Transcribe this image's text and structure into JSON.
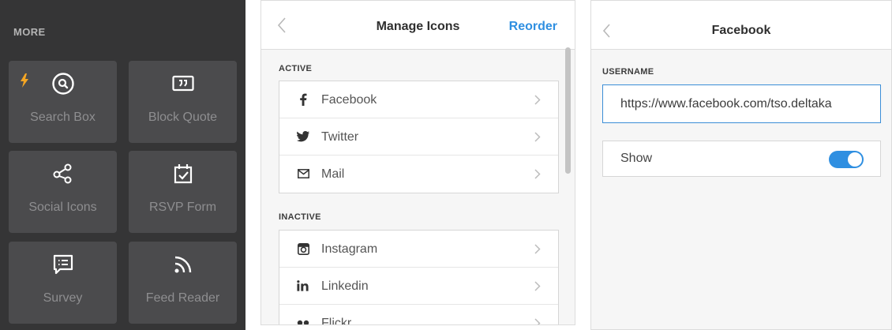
{
  "more_panel": {
    "title": "MORE",
    "tiles": [
      {
        "label": "Search Box",
        "icon": "search-icon"
      },
      {
        "label": "Block Quote",
        "icon": "quote-icon"
      },
      {
        "label": "Social Icons",
        "icon": "share-icon"
      },
      {
        "label": "RSVP Form",
        "icon": "calendar-check-icon"
      },
      {
        "label": "Survey",
        "icon": "survey-icon"
      },
      {
        "label": "Feed Reader",
        "icon": "rss-icon"
      }
    ],
    "accent_color": "#f5a623"
  },
  "manage_icons": {
    "title": "Manage Icons",
    "reorder_label": "Reorder",
    "active_label": "ACTIVE",
    "inactive_label": "INACTIVE",
    "active": [
      {
        "label": "Facebook",
        "icon": "facebook-icon"
      },
      {
        "label": "Twitter",
        "icon": "twitter-icon"
      },
      {
        "label": "Mail",
        "icon": "mail-icon"
      }
    ],
    "inactive": [
      {
        "label": "Instagram",
        "icon": "instagram-icon"
      },
      {
        "label": "Linkedin",
        "icon": "linkedin-icon"
      },
      {
        "label": "Flickr",
        "icon": "flickr-icon"
      }
    ],
    "link_color": "#2f8fe1"
  },
  "facebook_settings": {
    "title": "Facebook",
    "username_label": "USERNAME",
    "username_value": "https://www.facebook.com/tso.deltaka",
    "show_label": "Show",
    "show_enabled": true,
    "toggle_color": "#2f8fe1"
  }
}
